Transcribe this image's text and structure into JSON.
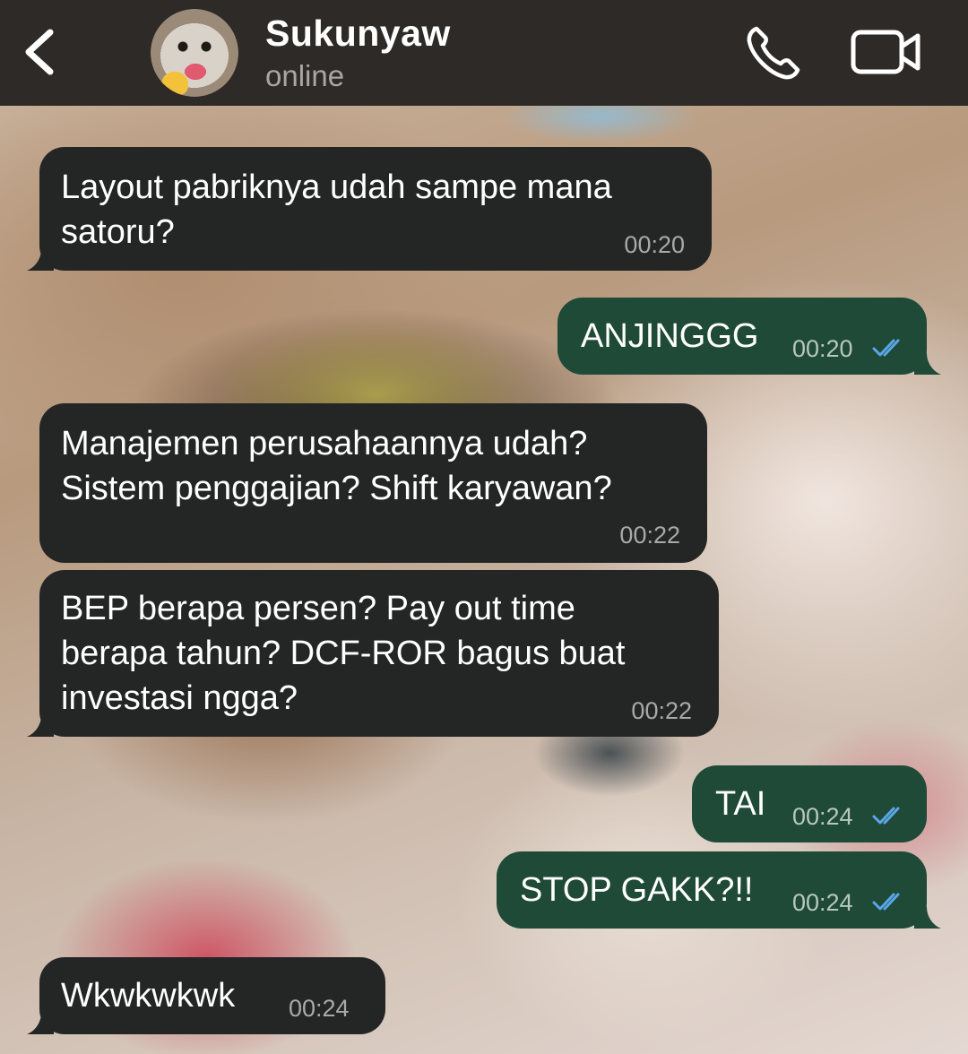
{
  "header": {
    "contact_name": "Sukunyaw",
    "status": "online"
  },
  "colors": {
    "header_bg": "#2d2a27",
    "incoming_bubble": "#242626",
    "outgoing_bubble": "#1f4a38",
    "read_ticks": "#5aa7e8"
  },
  "icons": {
    "back": "chevron-left-icon",
    "call": "phone-icon",
    "video": "video-camera-icon",
    "read_receipt": "double-check-icon"
  },
  "messages": [
    {
      "direction": "in",
      "text": "Layout pabriknya udah sampe mana\nsatoru?",
      "time": "00:20"
    },
    {
      "direction": "out",
      "text": "ANJINGGG",
      "time": "00:20",
      "read": true
    },
    {
      "direction": "in",
      "text": "Manajemen perusahaannya udah?\nSistem penggajian? Shift karyawan?",
      "time": "00:22"
    },
    {
      "direction": "in",
      "text": "BEP berapa persen? Pay out time\nberapa tahun? DCF-ROR bagus buat\ninvestasi ngga?",
      "time": "00:22"
    },
    {
      "direction": "out",
      "text": "TAI",
      "time": "00:24",
      "read": true
    },
    {
      "direction": "out",
      "text": "STOP GAKK?!!",
      "time": "00:24",
      "read": true
    },
    {
      "direction": "in",
      "text": "Wkwkwkwk",
      "time": "00:24"
    }
  ]
}
